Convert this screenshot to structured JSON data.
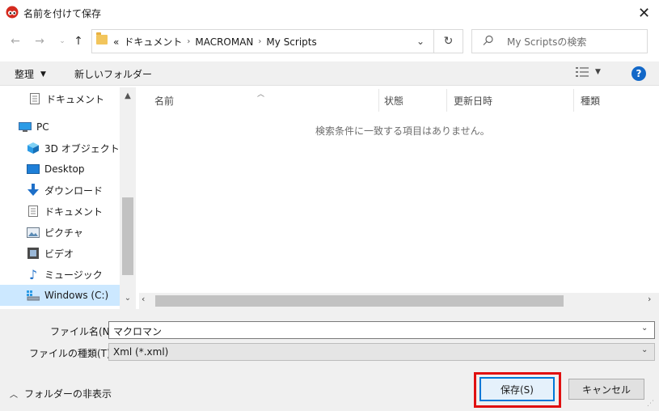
{
  "window": {
    "title": "名前を付けて保存",
    "close_glyph": "✕"
  },
  "address": {
    "overflow": "«",
    "crumbs": [
      "ドキュメント",
      "MACROMAN",
      "My Scripts"
    ],
    "separator": "›"
  },
  "search": {
    "placeholder": "My Scriptsの検索"
  },
  "toolbar": {
    "organize_label": "整理",
    "new_folder_label": "新しいフォルダー",
    "help_label": "?"
  },
  "nav": {
    "items": [
      {
        "label": "ドキュメント",
        "icon": "document-icon"
      },
      {
        "label": "PC",
        "icon": "pc-icon"
      },
      {
        "label": "3D オブジェクト",
        "icon": "3d-objects-icon"
      },
      {
        "label": "Desktop",
        "icon": "desktop-icon"
      },
      {
        "label": "ダウンロード",
        "icon": "download-icon"
      },
      {
        "label": "ドキュメント",
        "icon": "document-icon"
      },
      {
        "label": "ピクチャ",
        "icon": "pictures-icon"
      },
      {
        "label": "ビデオ",
        "icon": "video-icon"
      },
      {
        "label": "ミュージック",
        "icon": "music-icon"
      },
      {
        "label": "Windows (C:)",
        "icon": "drive-icon"
      }
    ],
    "selected_index": 9
  },
  "file_list": {
    "columns": [
      "名前",
      "状態",
      "更新日時",
      "種類"
    ],
    "empty_message": "検索条件に一致する項目はありません。"
  },
  "form": {
    "filename_label": "ファイル名(N):",
    "filename_value": "マクロマン",
    "filetype_label": "ファイルの種類(T):",
    "filetype_value": "Xml (*.xml)"
  },
  "footer": {
    "hide_folders_label": "フォルダーの非表示",
    "save_label": "保存(S)",
    "cancel_label": "キャンセル"
  },
  "colors": {
    "accent": "#0078d7",
    "highlight_box": "#e01010",
    "selection": "#cce8ff",
    "help": "#1368c8"
  }
}
